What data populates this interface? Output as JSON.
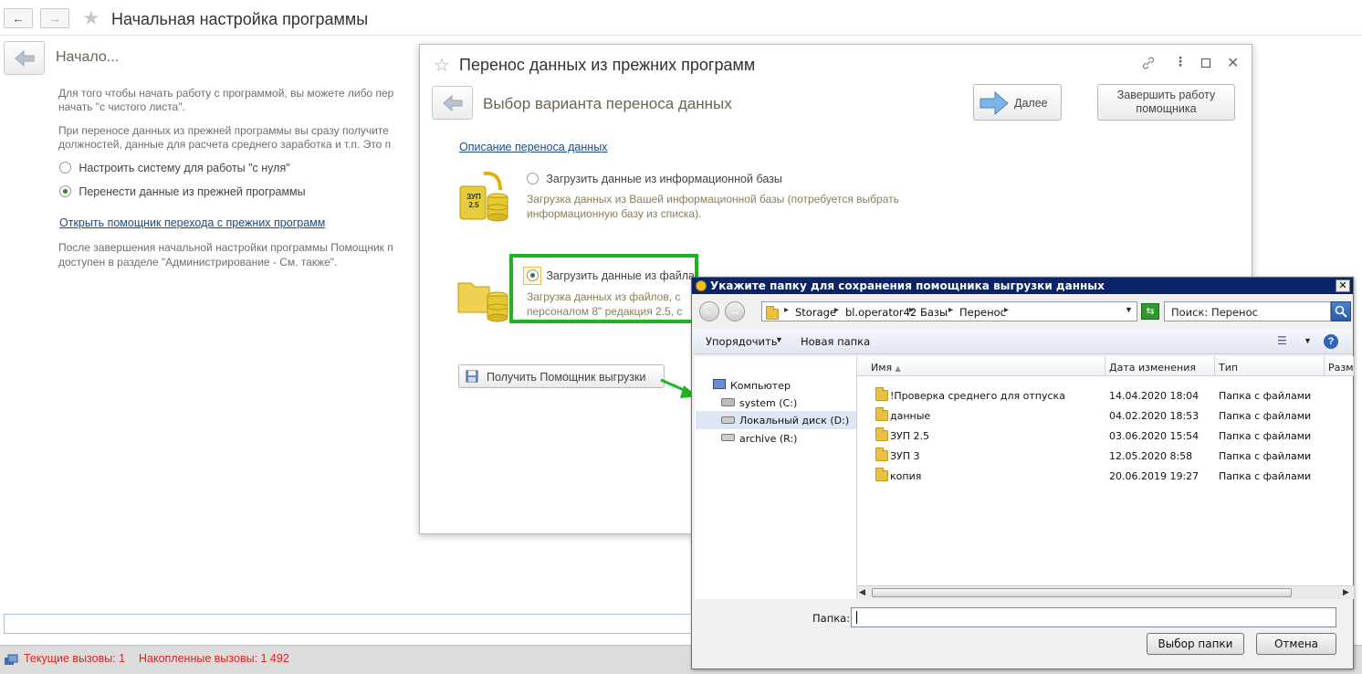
{
  "main": {
    "title": "Начальная настройка программы",
    "step_title": "Начало...",
    "para1": "Для того чтобы начать работу с программой, вы можете либо пер",
    "para1b": "начать \"с чистого листа\".",
    "para2": "При переносе данных из прежней программы вы сразу получите",
    "para2b": "должностей, данные для расчета среднего заработка и т.п. Это п",
    "option1": "Настроить систему для работы \"с нуля\"",
    "option2": "Перенести данные из прежней программы",
    "link": "Открыть помощник перехода с прежних программ",
    "para3": "После завершения начальной настройки программы Помощник п",
    "para3b": "доступен в разделе \"Администрирование - См. также\"."
  },
  "status": {
    "current_calls": "Текущие вызовы: 1",
    "accumulated_calls": "Накопленные вызовы: 1 492"
  },
  "dialog": {
    "title": "Перенос данных из прежних программ",
    "step_title": "Выбор варианта переноса данных",
    "next_label": "Далее",
    "finish_label_line1": "Завершить работу",
    "finish_label_line2": "помощника",
    "description_link": "Описание переноса данных",
    "opt_ib_label": "Загрузить данные из информационной базы",
    "opt_ib_desc1": "Загрузка данных из Вашей информационной базы (потребуется выбрать",
    "opt_ib_desc2": "информационную базу из списка).",
    "opt_file_label": "Загрузить данные из файла",
    "opt_file_desc1": "Загрузка данных из файлов, с",
    "opt_file_desc2": "персоналом 8\" редакция 2.5, с",
    "get_helper_label": "Получить Помощник выгрузки",
    "db_icon_label": "ЗУП 2.5"
  },
  "picker": {
    "title": "Укажите папку для сохранения помощника выгрузки данных",
    "close_glyph": "✕",
    "breadcrumb": [
      "Storage",
      "bl.operator42",
      "Базы",
      "Перенос"
    ],
    "search_placeholder": "Поиск: Перенос",
    "organize_label": "Упорядочить",
    "new_folder_label": "Новая папка",
    "tree": [
      {
        "label": "Компьютер"
      },
      {
        "label": "system (C:)"
      },
      {
        "label": "Локальный диск (D:)"
      },
      {
        "label": "archive (R:)"
      }
    ],
    "columns": [
      "Имя",
      "Дата изменения",
      "Тип",
      "Разме"
    ],
    "rows": [
      {
        "name": "!Проверка среднего для отпуска",
        "date": "14.04.2020 18:04",
        "type": "Папка с файлами"
      },
      {
        "name": "данные",
        "date": "04.02.2020 18:53",
        "type": "Папка с файлами"
      },
      {
        "name": "ЗУП 2.5",
        "date": "03.06.2020 15:54",
        "type": "Папка с файлами"
      },
      {
        "name": "ЗУП 3",
        "date": "12.05.2020 8:58",
        "type": "Папка с файлами"
      },
      {
        "name": "копия",
        "date": "20.06.2019 19:27",
        "type": "Папка с файлами"
      }
    ],
    "folder_label": "Папка:",
    "folder_value": "",
    "select_label": "Выбор папки",
    "cancel_label": "Отмена"
  },
  "colors": {
    "highlight_green": "#1fb31f",
    "status_red": "#e0201a",
    "win_title_blue": "#0a246a"
  }
}
